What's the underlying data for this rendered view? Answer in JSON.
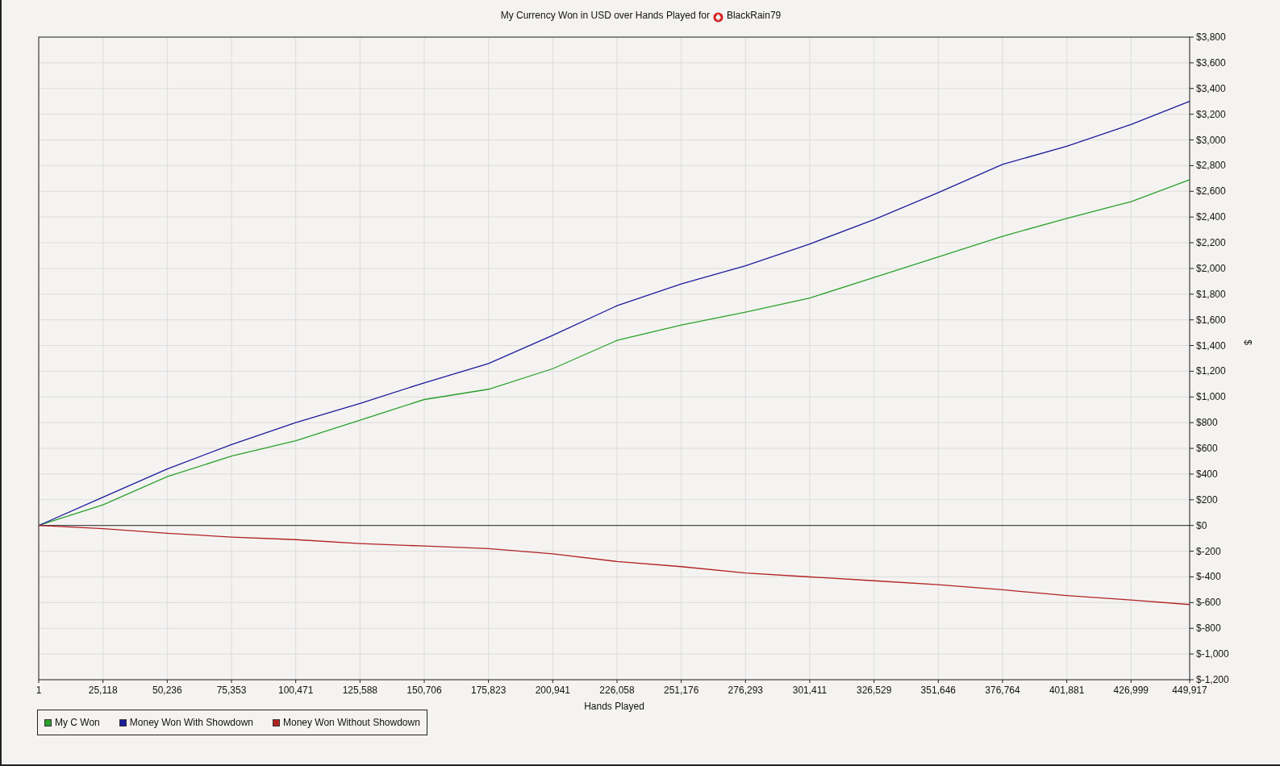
{
  "player_name": "BlackRain79",
  "chart_data": {
    "type": "line",
    "title": "My Currency Won in USD over Hands Played for",
    "xlabel": "Hands Played",
    "ylabel": "$",
    "x": [
      1,
      25118,
      50236,
      75353,
      100471,
      125588,
      150706,
      175823,
      200941,
      226058,
      251176,
      276293,
      301411,
      326529,
      351646,
      376764,
      401881,
      426999,
      449917
    ],
    "series": [
      {
        "name": "My C Won",
        "color": "#2ca02c",
        "values": [
          0,
          160,
          380,
          540,
          660,
          820,
          980,
          1060,
          1220,
          1440,
          1560,
          1660,
          1770,
          1930,
          2090,
          2250,
          2390,
          2520,
          2690
        ]
      },
      {
        "name": "Money Won With Showdown",
        "color": "#1c1c9c",
        "values": [
          0,
          220,
          440,
          630,
          800,
          950,
          1110,
          1260,
          1480,
          1710,
          1880,
          2020,
          2190,
          2380,
          2590,
          2810,
          2950,
          3120,
          3300
        ]
      },
      {
        "name": "Money Won Without Showdown",
        "color": "#b22222",
        "values": [
          0,
          -25,
          -60,
          -90,
          -110,
          -140,
          -160,
          -180,
          -220,
          -280,
          -320,
          -370,
          -400,
          -430,
          -460,
          -500,
          -545,
          -580,
          -615
        ]
      }
    ],
    "grid": true,
    "legend": true,
    "xlim": [
      1,
      449917
    ],
    "ylim": [
      -1200,
      3800
    ],
    "xticks": [
      {
        "value": 1,
        "label": "1"
      },
      {
        "value": 25118,
        "label": "25,118"
      },
      {
        "value": 50236,
        "label": "50,236"
      },
      {
        "value": 75353,
        "label": "75,353"
      },
      {
        "value": 100471,
        "label": "100,471"
      },
      {
        "value": 125588,
        "label": "125,588"
      },
      {
        "value": 150706,
        "label": "150,706"
      },
      {
        "value": 175823,
        "label": "175,823"
      },
      {
        "value": 200941,
        "label": "200,941"
      },
      {
        "value": 226058,
        "label": "226,058"
      },
      {
        "value": 251176,
        "label": "251,176"
      },
      {
        "value": 276293,
        "label": "276,293"
      },
      {
        "value": 301411,
        "label": "301,411"
      },
      {
        "value": 326529,
        "label": "326,529"
      },
      {
        "value": 351646,
        "label": "351,646"
      },
      {
        "value": 376764,
        "label": "376,764"
      },
      {
        "value": 401881,
        "label": "401,881"
      },
      {
        "value": 426999,
        "label": "426,999"
      },
      {
        "value": 449917,
        "label": "449,917"
      }
    ],
    "yticks": [
      {
        "value": 3800,
        "label": "$3,800"
      },
      {
        "value": 3600,
        "label": "$3,600"
      },
      {
        "value": 3400,
        "label": "$3,400"
      },
      {
        "value": 3200,
        "label": "$3,200"
      },
      {
        "value": 3000,
        "label": "$3,000"
      },
      {
        "value": 2800,
        "label": "$2,800"
      },
      {
        "value": 2600,
        "label": "$2,600"
      },
      {
        "value": 2400,
        "label": "$2,400"
      },
      {
        "value": 2200,
        "label": "$2,200"
      },
      {
        "value": 2000,
        "label": "$2,000"
      },
      {
        "value": 1800,
        "label": "$1,800"
      },
      {
        "value": 1600,
        "label": "$1,600"
      },
      {
        "value": 1400,
        "label": "$1,400"
      },
      {
        "value": 1200,
        "label": "$1,200"
      },
      {
        "value": 1000,
        "label": "$1,000"
      },
      {
        "value": 800,
        "label": "$800"
      },
      {
        "value": 600,
        "label": "$600"
      },
      {
        "value": 400,
        "label": "$400"
      },
      {
        "value": 200,
        "label": "$200"
      },
      {
        "value": 0,
        "label": "$0"
      },
      {
        "value": -200,
        "label": "$-200"
      },
      {
        "value": -400,
        "label": "$-400"
      },
      {
        "value": -600,
        "label": "$-600"
      },
      {
        "value": -800,
        "label": "$-800"
      },
      {
        "value": -1000,
        "label": "$-1,000"
      },
      {
        "value": -1200,
        "label": "$-1,200"
      }
    ]
  }
}
